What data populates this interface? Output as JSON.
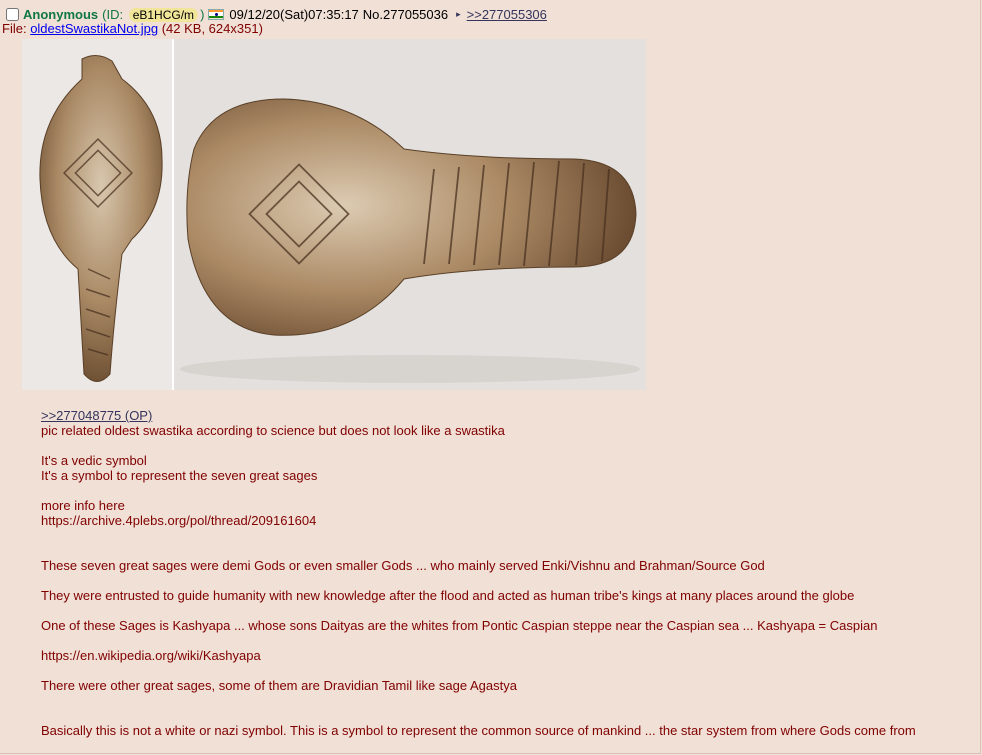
{
  "post": {
    "name": "Anonymous",
    "id_prefix": "(ID:",
    "id_value": "eB1HCG/m",
    "id_suffix": ")",
    "flag": "india-flag-icon",
    "datetime": "09/12/20(Sat)07:35:17",
    "number": "No.277055036",
    "arrow": "▸",
    "backlink": ">>277055306",
    "file_prefix": "File:",
    "file_name": "oldestSwastikaNot.jpg",
    "file_meta": "(42 KB, 624x351)",
    "image_alt": "carved stone artifact",
    "quotelink": ">>277048775 (OP)",
    "lines": [
      "pic related oldest swastika according to science but does not look like a swastika",
      "",
      "It's a vedic symbol",
      "It's a symbol to represent the seven great sages",
      "",
      "more info here",
      "https://archive.4plebs.org/pol/thread/209161604",
      "",
      "",
      "These seven great sages were demi Gods or even smaller Gods ... who mainly served Enki/Vishnu and Brahman/Source God",
      "",
      "They were entrusted to guide humanity with new knowledge after the flood and acted as human tribe's kings at many places around the globe",
      "",
      "One of these Sages is Kashyapa ... whose sons Daityas are the whites from Pontic Caspian steppe near the Caspian sea ... Kashyapa = Caspian",
      "",
      "https://en.wikipedia.org/wiki/Kashyapa",
      "",
      "There were other great sages, some of them are Dravidian Tamil like sage Agastya",
      "",
      "",
      "Basically this is not a white or nazi symbol. This is a symbol to represent the common source of mankind ... the star system from where Gods come from"
    ]
  },
  "colors": {
    "background": "#f0e0d6",
    "text": "#800000",
    "name": "#117743",
    "link": "#34345c",
    "id_badge": "#f1e59a"
  }
}
